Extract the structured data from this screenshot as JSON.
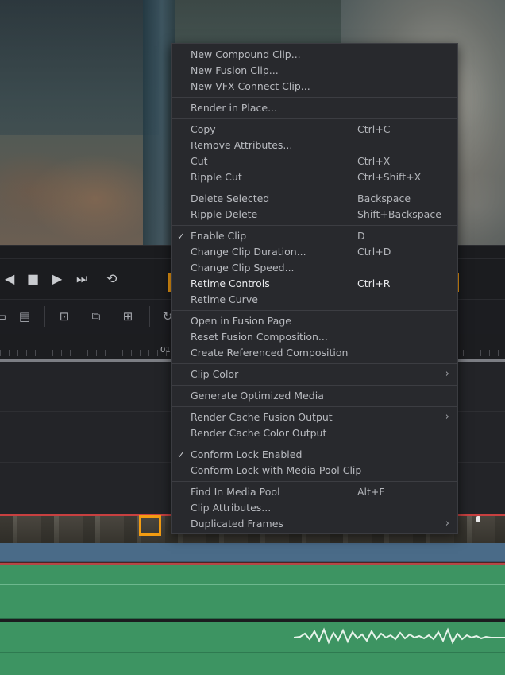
{
  "transport": {
    "icons": [
      "rewind-icon",
      "stop-icon",
      "play-icon",
      "skip-end-icon",
      "loop-icon"
    ]
  },
  "toolbar": {
    "icons": [
      "blade-icon",
      "razor-icon",
      "insert-clip-icon",
      "overwrite-clip-icon",
      "replace-clip-icon",
      "snap-icon"
    ]
  },
  "timeline": {
    "ruler_label": "01"
  },
  "context_menu": {
    "groups": [
      {
        "items": [
          {
            "label": "New Compound Clip...",
            "shortcut": ""
          },
          {
            "label": "New Fusion Clip...",
            "shortcut": ""
          },
          {
            "label": "New VFX Connect Clip...",
            "shortcut": ""
          }
        ]
      },
      {
        "items": [
          {
            "label": "Render in Place...",
            "shortcut": ""
          }
        ]
      },
      {
        "items": [
          {
            "label": "Copy",
            "shortcut": "Ctrl+C"
          },
          {
            "label": "Remove Attributes...",
            "shortcut": ""
          },
          {
            "label": "Cut",
            "shortcut": "Ctrl+X"
          },
          {
            "label": "Ripple Cut",
            "shortcut": "Ctrl+Shift+X"
          }
        ]
      },
      {
        "items": [
          {
            "label": "Delete Selected",
            "shortcut": "Backspace"
          },
          {
            "label": "Ripple Delete",
            "shortcut": "Shift+Backspace"
          }
        ]
      },
      {
        "items": [
          {
            "label": "Enable Clip",
            "shortcut": "D",
            "checked": true
          },
          {
            "label": "Change Clip Duration...",
            "shortcut": "Ctrl+D"
          },
          {
            "label": "Change Clip Speed...",
            "shortcut": ""
          },
          {
            "label": "Retime Controls",
            "shortcut": "Ctrl+R",
            "highlighted": true
          },
          {
            "label": "Retime Curve",
            "shortcut": ""
          }
        ]
      },
      {
        "items": [
          {
            "label": "Open in Fusion Page",
            "shortcut": ""
          },
          {
            "label": "Reset Fusion Composition...",
            "shortcut": ""
          },
          {
            "label": "Create Referenced Composition",
            "shortcut": ""
          }
        ]
      },
      {
        "items": [
          {
            "label": "Clip Color",
            "shortcut": "",
            "submenu": true
          }
        ]
      },
      {
        "items": [
          {
            "label": "Generate Optimized Media",
            "shortcut": ""
          }
        ]
      },
      {
        "items": [
          {
            "label": "Render Cache Fusion Output",
            "shortcut": "",
            "submenu": true
          },
          {
            "label": "Render Cache Color Output",
            "shortcut": ""
          }
        ]
      },
      {
        "items": [
          {
            "label": "Conform Lock Enabled",
            "shortcut": "",
            "checked": true
          },
          {
            "label": "Conform Lock with Media Pool Clip",
            "shortcut": ""
          }
        ]
      },
      {
        "items": [
          {
            "label": "Find In Media Pool",
            "shortcut": "Alt+F"
          },
          {
            "label": "Clip Attributes...",
            "shortcut": ""
          },
          {
            "label": "Duplicated Frames",
            "shortcut": "",
            "submenu": true
          }
        ]
      }
    ]
  },
  "colors": {
    "highlight_outline": "#f39c12",
    "menu_bg": "#28292d",
    "audio_track": "#3d9462",
    "video_track_top": "#c84040"
  }
}
